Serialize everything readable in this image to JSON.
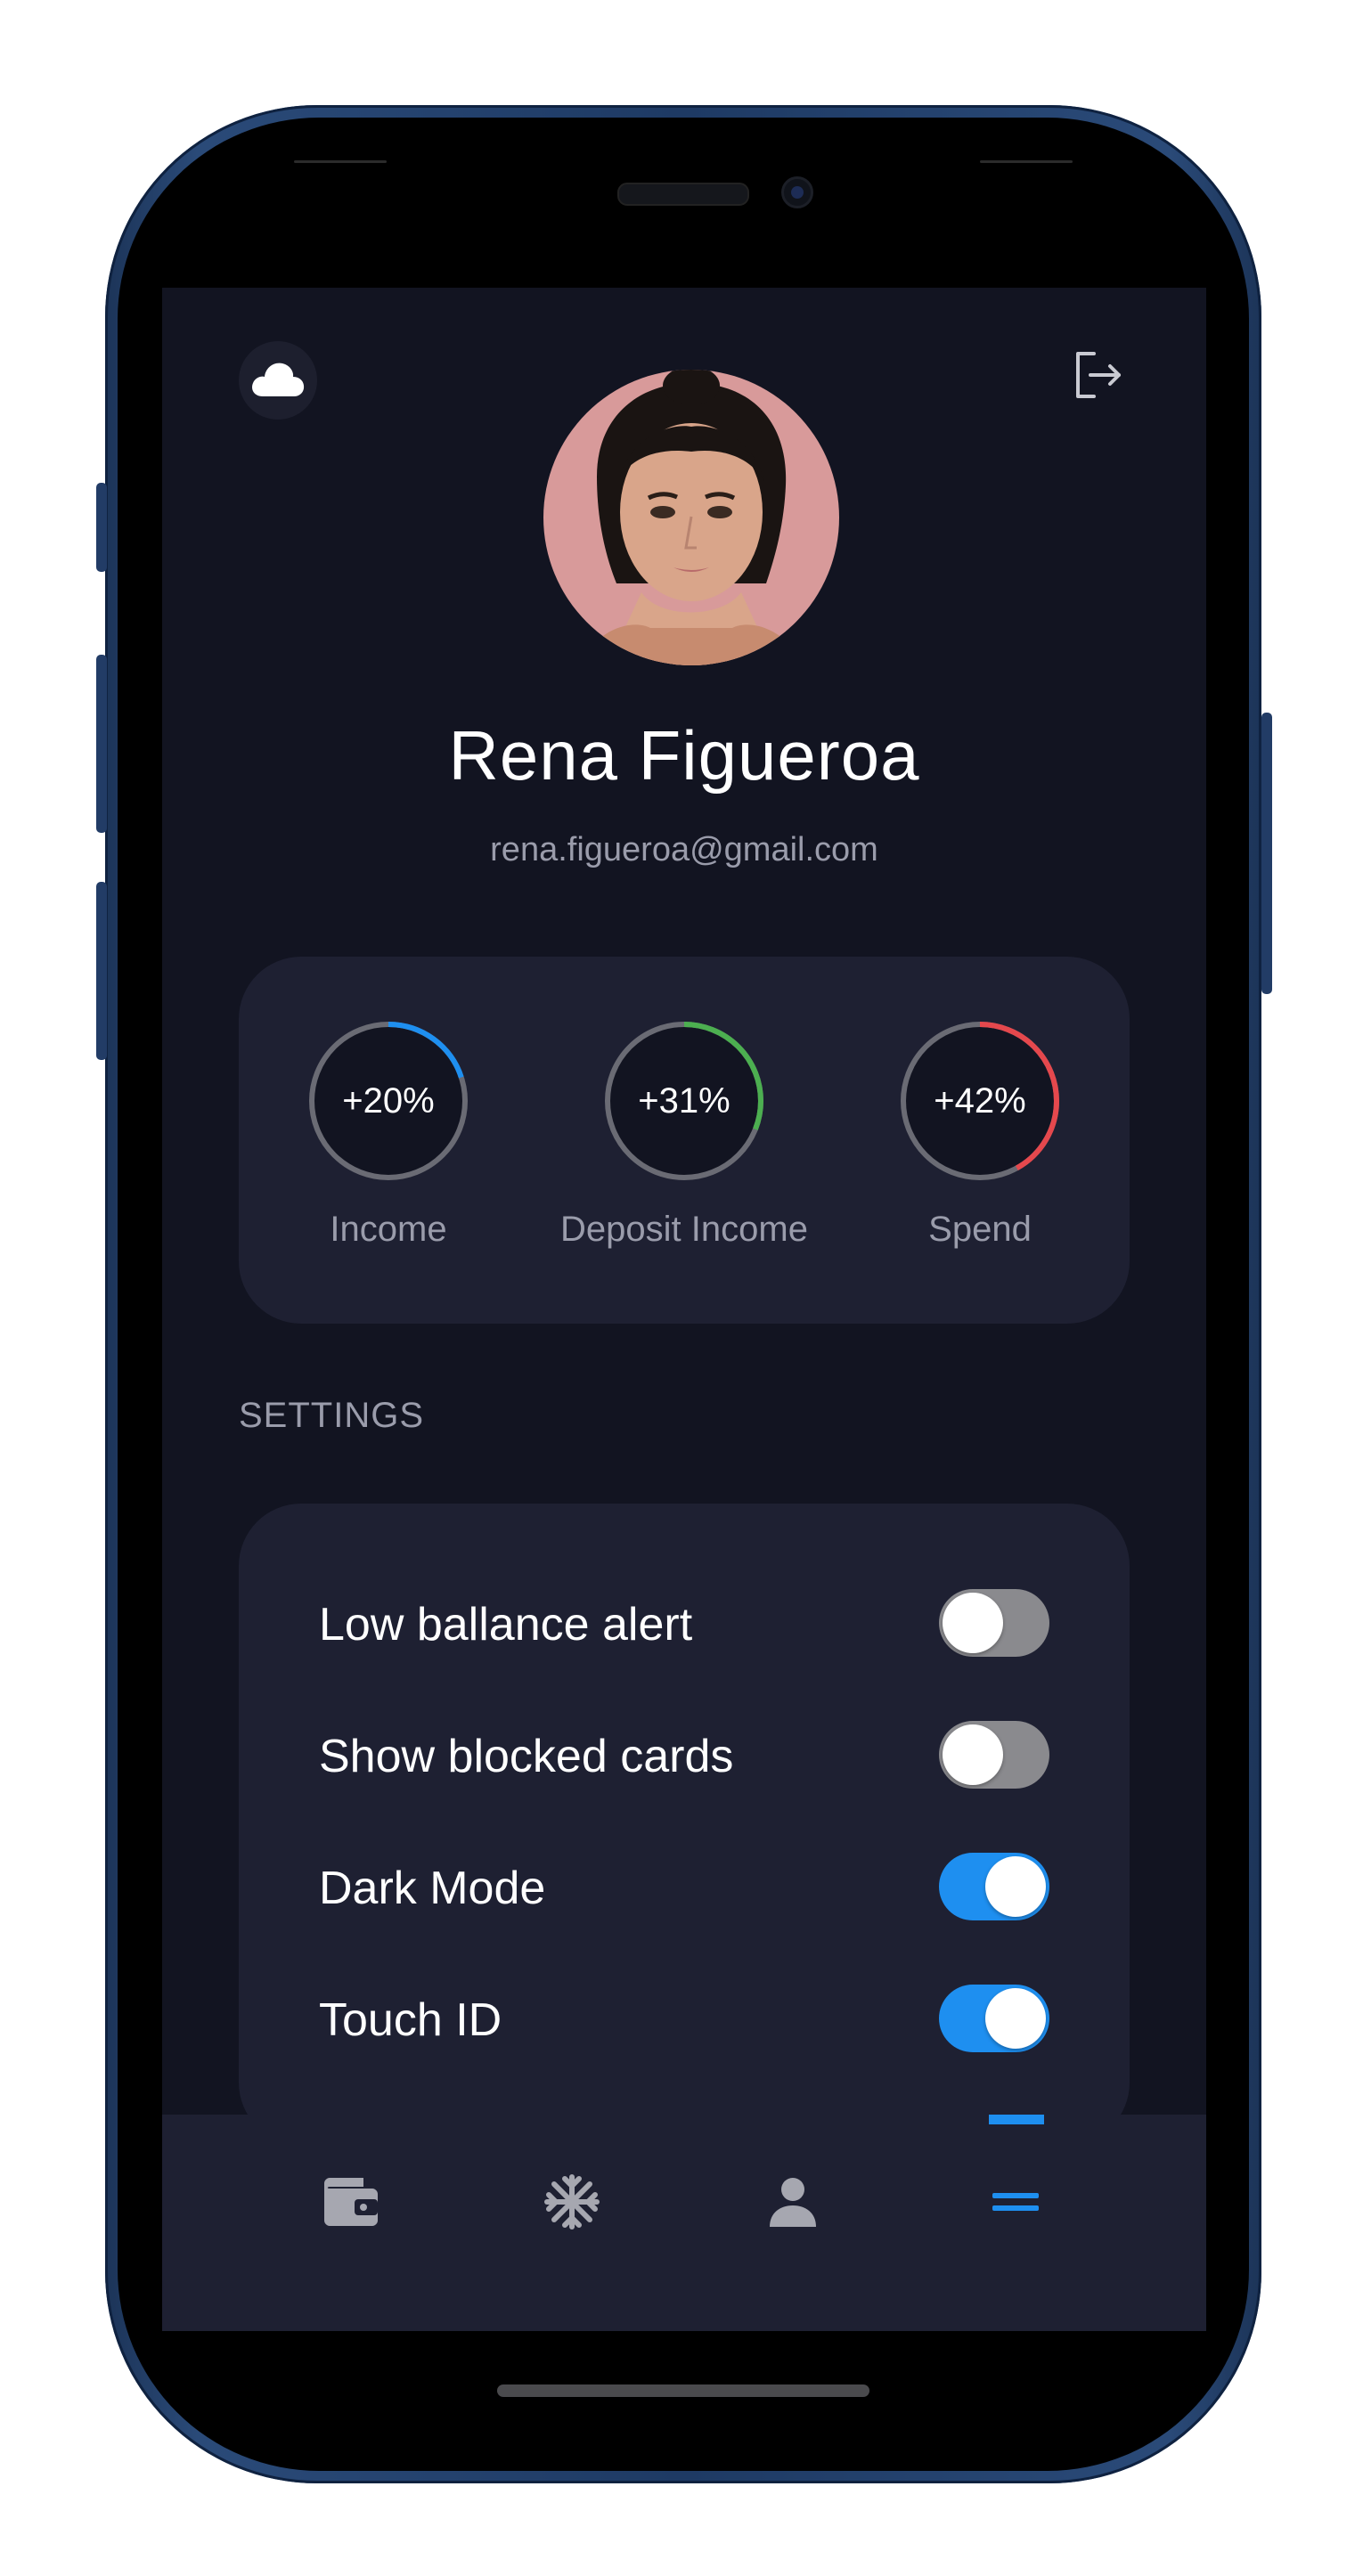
{
  "profile": {
    "name": "Rena Figueroa",
    "email": "rena.figueroa@gmail.com",
    "avatar_icon": "avatar-photo"
  },
  "header": {
    "left_icon": "cloud-icon",
    "right_icon": "logout-icon"
  },
  "stats": [
    {
      "value": "+20%",
      "label": "Income",
      "progress": 0.2,
      "color": "#1e8ff0"
    },
    {
      "value": "+31%",
      "label": "Deposit Income",
      "progress": 0.31,
      "color": "#4caf50"
    },
    {
      "value": "+42%",
      "label": "Spend",
      "progress": 0.42,
      "color": "#e5484d"
    }
  ],
  "settings": {
    "title": "SETTINGS",
    "items": [
      {
        "label": "Low ballance alert",
        "enabled": false
      },
      {
        "label": "Show blocked cards",
        "enabled": false
      },
      {
        "label": "Dark Mode",
        "enabled": true
      },
      {
        "label": "Touch ID",
        "enabled": true
      }
    ]
  },
  "nav": {
    "items": [
      {
        "icon": "wallet-icon",
        "active": false
      },
      {
        "icon": "snowflake-icon",
        "active": false
      },
      {
        "icon": "person-icon",
        "active": false
      },
      {
        "icon": "menu-icon",
        "active": true
      }
    ]
  },
  "colors": {
    "accent": "#1e8ff0",
    "background": "#121421",
    "card": "#1e2032",
    "muted_text": "#9a9cab"
  }
}
